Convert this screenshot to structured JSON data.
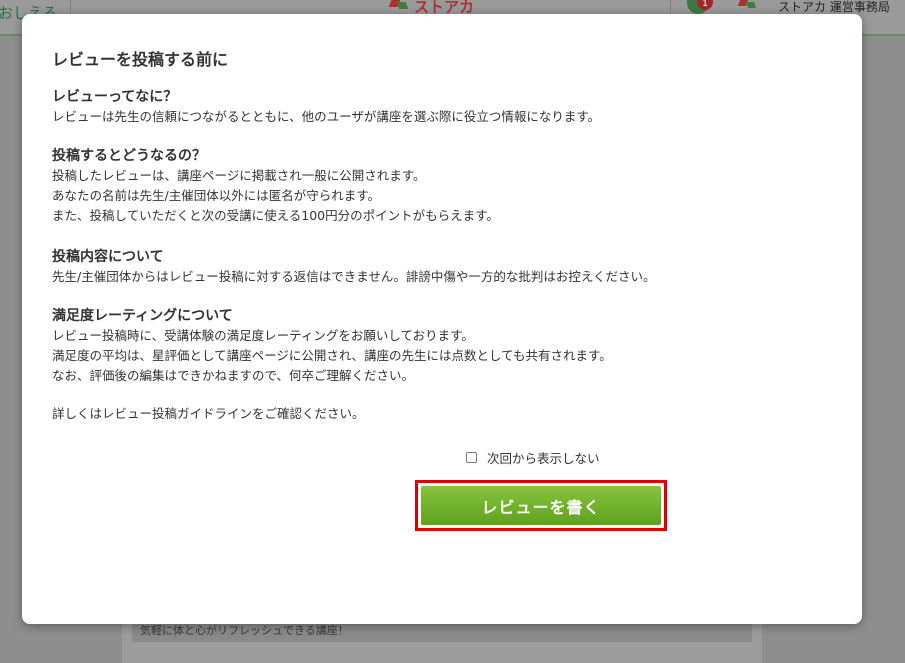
{
  "background": {
    "header_left_text": "おしえる",
    "logo_text": "ストアカ",
    "notification_count": "1",
    "org_name": "ストアカ 運営事務局",
    "card_text": "気軽に体と心がリフレッシュできる講座！"
  },
  "modal": {
    "title": "レビューを投稿する前に",
    "sections": [
      {
        "heading": "レビューってなに？",
        "lines": [
          "レビューは先生の信頼につながるとともに、他のユーザが講座を選ぶ際に役立つ情報になります。"
        ]
      },
      {
        "heading": "投稿するとどうなるの？",
        "lines": [
          "投稿したレビューは、講座ページに掲載され一般に公開されます。",
          "あなたの名前は先生/主催団体以外には匿名が守られます。",
          "また、投稿していただくと次の受講に使える100円分のポイントがもらえます。"
        ]
      },
      {
        "heading": "投稿内容について",
        "lines": [
          "先生/主催団体からはレビュー投稿に対する返信はできません。誹謗中傷や一方的な批判はお控えください。"
        ]
      },
      {
        "heading": "満足度レーティングについて",
        "lines": [
          "レビュー投稿時に、受講体験の満足度レーティングをお願いしております。",
          "満足度の平均は、星評価として講座ページに公開され、講座の先生には点数としても共有されます。",
          "なお、評価後の編集はできかねますので、何卒ご理解ください。"
        ]
      }
    ],
    "footnote": "詳しくはレビュー投稿ガイドラインをご確認ください。",
    "checkbox_label": "次回から表示しない",
    "checkbox_checked": false,
    "cta_label": "レビューを書く",
    "cta_color": "#6fb22c",
    "highlight_color": "#e00000"
  }
}
